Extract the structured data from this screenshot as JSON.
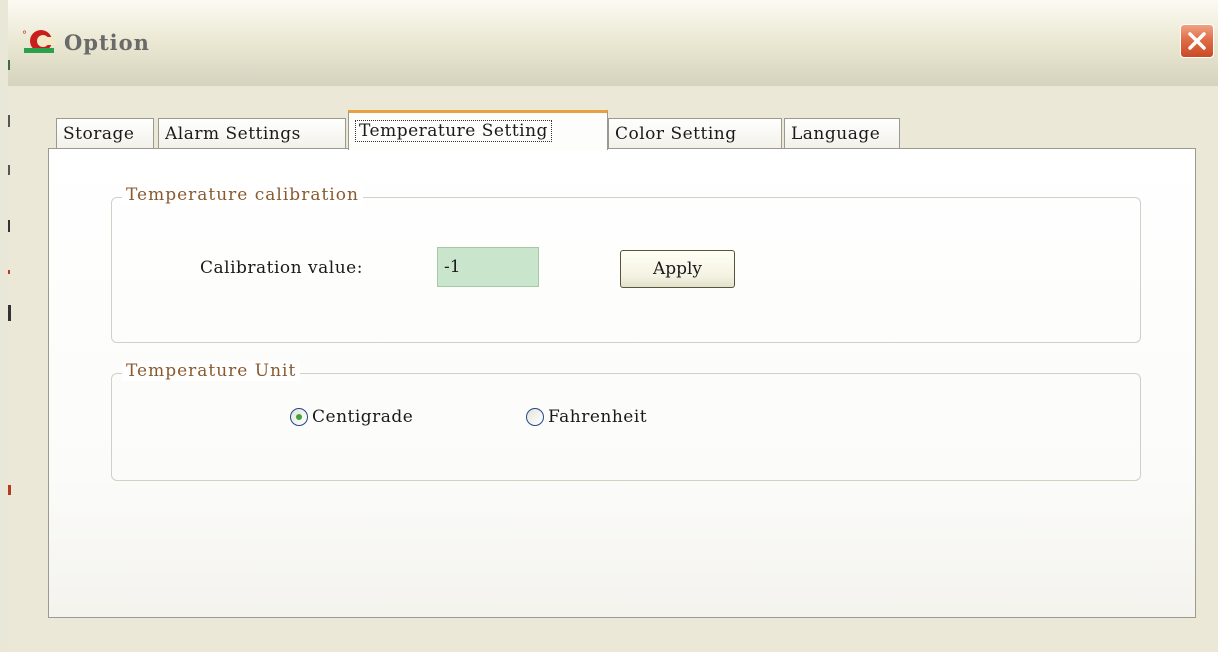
{
  "window": {
    "title": "Option",
    "close_label": "×"
  },
  "tabs": [
    {
      "label": "Storage",
      "active": false
    },
    {
      "label": "Alarm Settings",
      "active": false
    },
    {
      "label": "Temperature Setting",
      "active": true
    },
    {
      "label": "Color Setting",
      "active": false
    },
    {
      "label": "Language",
      "active": false
    }
  ],
  "calibration": {
    "group_title": "Temperature calibration",
    "label": "Calibration value:",
    "value": "-1",
    "apply_label": "Apply"
  },
  "unit": {
    "group_title": "Temperature Unit",
    "options": [
      {
        "label": "Centigrade",
        "selected": true
      },
      {
        "label": "Fahrenheit",
        "selected": false
      }
    ]
  },
  "colors": {
    "input_bg": "#c9e6cc",
    "group_title": "#8a5a2e",
    "active_tab_accent": "#e8a040",
    "close_button": "#e06d48",
    "radio_dot": "#3ea43a"
  },
  "icons": {
    "app": "app-logo-icon",
    "close": "close-icon"
  }
}
